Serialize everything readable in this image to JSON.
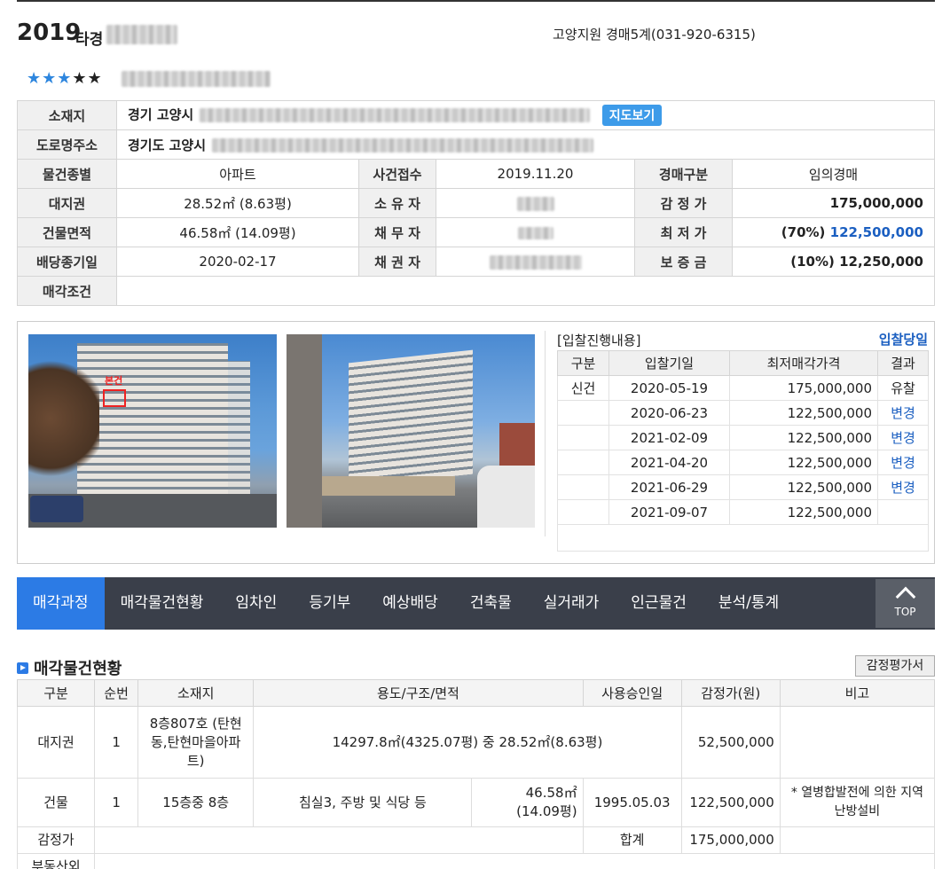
{
  "header": {
    "case_year": "2019",
    "case_type": "타경",
    "court": "고양지원 경매5계(031-920-6315)"
  },
  "rating": {
    "stars_on": "★★★",
    "stars_off": "★★"
  },
  "info": {
    "location_label": "소재지",
    "location_prefix": "경기 고양시",
    "map_button": "지도보기",
    "road_label": "도로명주소",
    "road_prefix": "경기도 고양시",
    "rows": [
      [
        "물건종별",
        "아파트",
        "사건접수",
        "2019.11.20",
        "경매구분",
        "임의경매"
      ],
      [
        "대지권",
        "28.52㎡ (8.63평)",
        "소 유 자",
        "",
        "감 정 가",
        "175,000,000"
      ],
      [
        "건물면적",
        "46.58㎡ (14.09평)",
        "채 무 자",
        "",
        "최 저 가",
        "(70%)",
        "122,500,000"
      ],
      [
        "배당종기일",
        "2020-02-17",
        "채 권 자",
        "",
        "보 증 금",
        "(10%) 12,250,000"
      ]
    ],
    "sale_cond_label": "매각조건"
  },
  "photo_marker": "본건",
  "bids": {
    "title": "[입찰진행내용]",
    "day_link": "입찰당일",
    "headers": [
      "구분",
      "입찰기일",
      "최저매각가격",
      "결과"
    ],
    "rows": [
      [
        "신건",
        "2020-05-19",
        "175,000,000",
        "유찰"
      ],
      [
        "",
        "2020-06-23",
        "122,500,000",
        "변경"
      ],
      [
        "",
        "2021-02-09",
        "122,500,000",
        "변경"
      ],
      [
        "",
        "2021-04-20",
        "122,500,000",
        "변경"
      ],
      [
        "",
        "2021-06-29",
        "122,500,000",
        "변경"
      ],
      [
        "",
        "2021-09-07",
        "122,500,000",
        ""
      ]
    ]
  },
  "nav": {
    "items": [
      "매각과정",
      "매각물건현황",
      "임차인",
      "등기부",
      "예상배당",
      "건축물",
      "실거래가",
      "인근물건",
      "분석/통계"
    ],
    "top": "TOP"
  },
  "items": {
    "title": "매각물건현황",
    "appraisal_button": "감정평가서",
    "headers": [
      "구분",
      "순번",
      "소재지",
      "용도/구조/면적",
      "사용승인일",
      "감정가(원)",
      "비고"
    ],
    "row1": {
      "type": "대지권",
      "no": "1",
      "loc": "8층807호 (탄현동,탄현마을아파트)",
      "desc": "14297.8㎡(4325.07평) 중 28.52㎡(8.63평)",
      "price": "52,500,000"
    },
    "row2": {
      "type": "건물",
      "no": "1",
      "loc": "15층중 8층",
      "use": "침실3, 주방 및 식당 등",
      "area": "46.58㎡ (14.09평)",
      "date": "1995.05.03",
      "price": "122,500,000",
      "note": "* 열병합발전에 의한 지역난방설비"
    },
    "total": {
      "label": "감정가",
      "sum_label": "합계",
      "sum": "175,000,000"
    },
    "next_label": "부동산외"
  },
  "colors": {
    "accent": "#2c7be5",
    "nav_bg": "#3a3f4a",
    "link": "#1b5fc1"
  }
}
